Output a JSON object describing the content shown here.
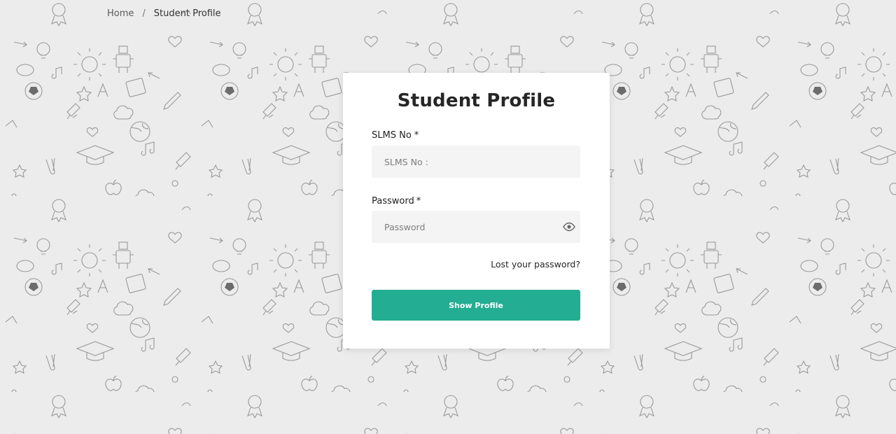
{
  "breadcrumb": {
    "home": "Home",
    "separator": "/",
    "current": "Student Profile"
  },
  "form": {
    "title": "Student Profile",
    "slms": {
      "label": "SLMS No",
      "required_mark": "*",
      "placeholder": "SLMS No :",
      "value": ""
    },
    "password": {
      "label": "Password",
      "required_mark": "*",
      "placeholder": "Password",
      "value": "",
      "toggle_icon": "eye-icon"
    },
    "lost_password": "Lost your password?",
    "submit": "Show Profile"
  },
  "colors": {
    "background": "#ececec",
    "doodle": "#8a8a8a",
    "card": "#ffffff",
    "input": "#f4f4f4",
    "button": "#23ad92",
    "button_text": "#ffffff"
  }
}
